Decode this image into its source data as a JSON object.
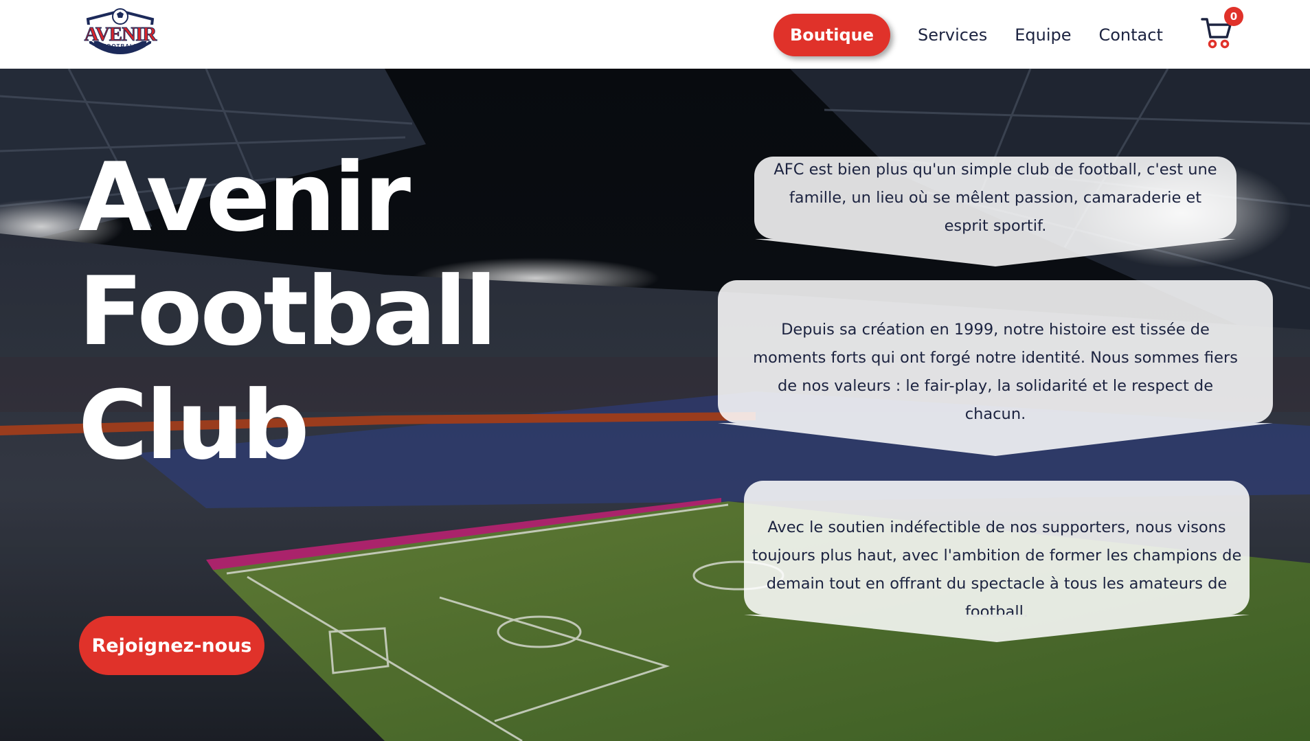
{
  "header": {
    "logo": {
      "word": "AVENIR",
      "sub": "FOOTBALL",
      "sub2": "CLUB"
    },
    "nav": {
      "shop_label": "Boutique",
      "links": [
        "Services",
        "Equipe",
        "Contact"
      ]
    },
    "cart": {
      "icon": "cart-icon",
      "count": "0"
    }
  },
  "hero": {
    "title_lines": [
      "Avenir",
      "Football",
      "Club"
    ],
    "cta_label": "Rejoignez-nous",
    "bubbles": [
      "AFC est bien plus qu'un simple club de football, c'est une famille, un lieu où se mêlent passion, camaraderie et esprit sportif.",
      "Depuis sa création en 1999, notre histoire est tissée de moments forts qui ont forgé notre identité. Nous sommes fiers de nos valeurs : le fair-play, la solidarité et le respect de chacun.",
      "Avec le soutien indéfectible de nos supporters, nous visons toujours plus haut, avec l'ambition de former les champions de demain tout en offrant du spectacle à tous les amateurs de football."
    ]
  },
  "colors": {
    "accent": "#e0322a",
    "navy": "#1c2340",
    "pitch": "#4e7a2e"
  }
}
